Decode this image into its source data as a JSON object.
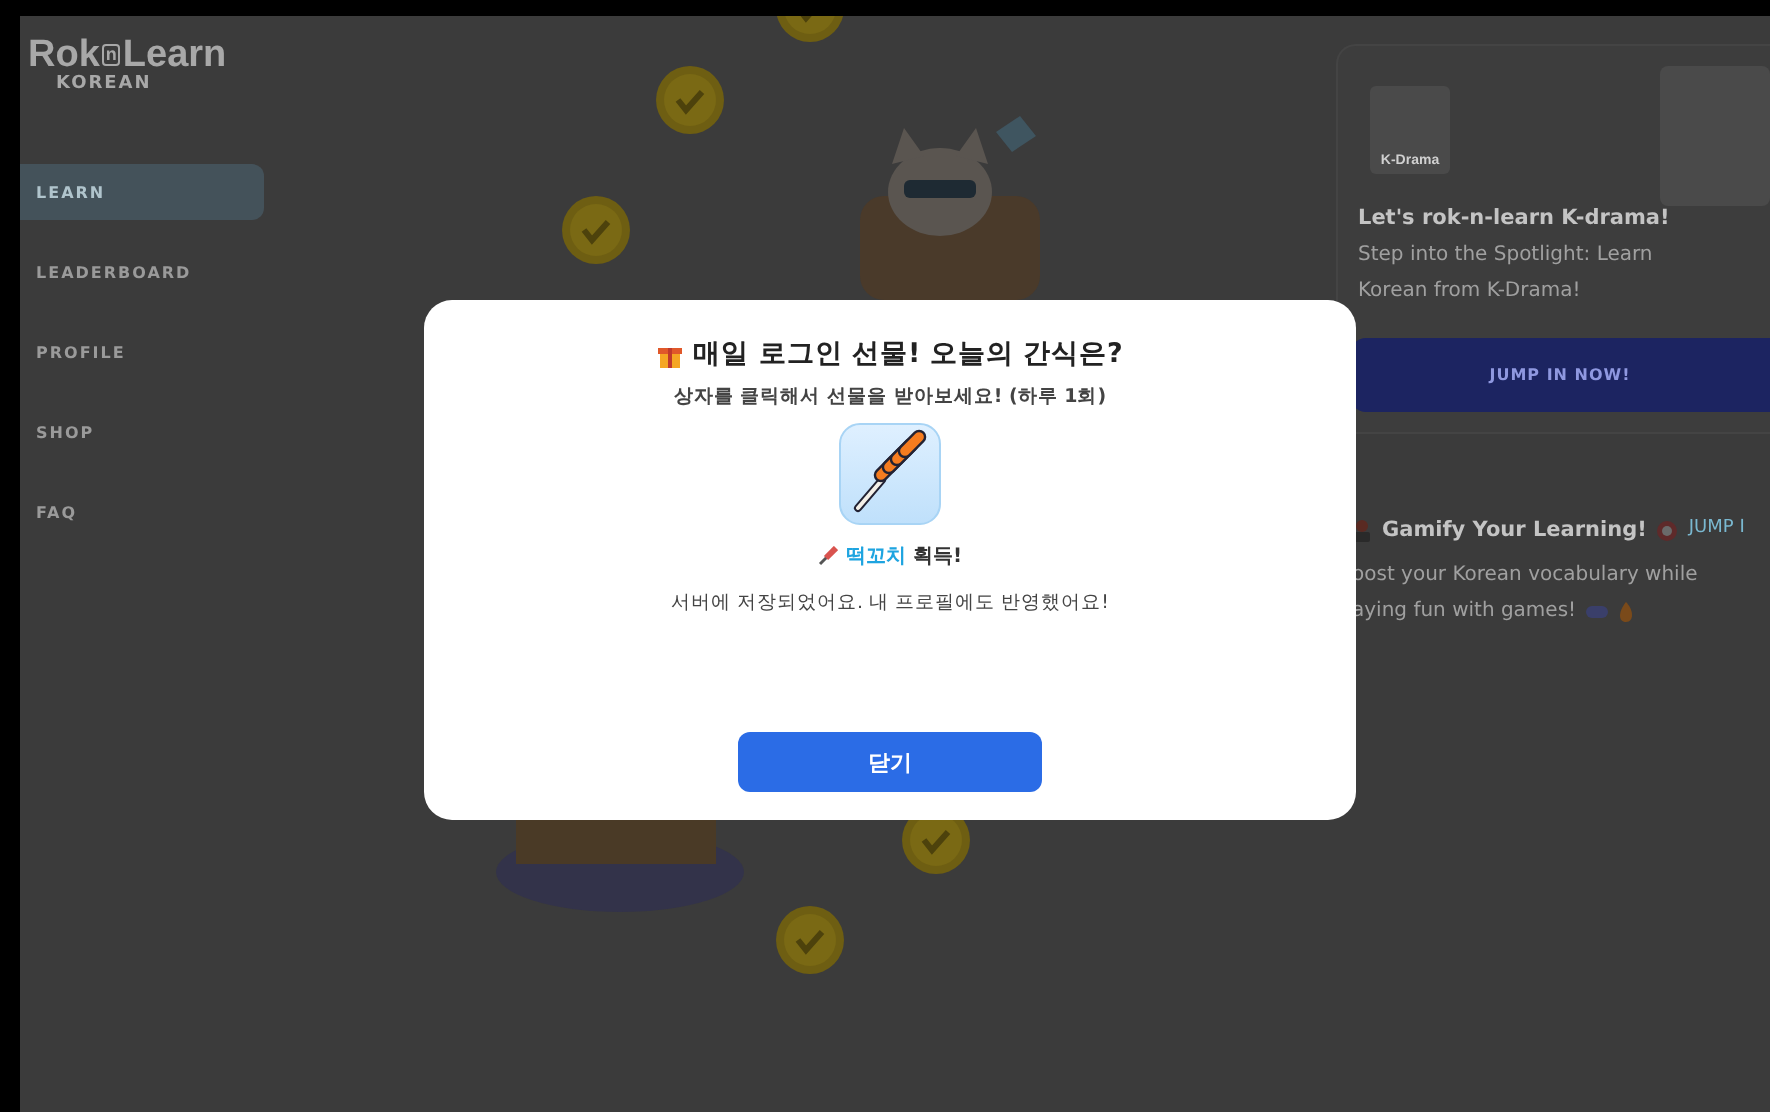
{
  "logo": {
    "parts": [
      "Rok",
      "n",
      "Learn"
    ],
    "subtitle": "KOREAN"
  },
  "sidebar": {
    "items": [
      {
        "label": "LEARN",
        "selected": true
      },
      {
        "label": "LEADERBOARD",
        "selected": false
      },
      {
        "label": "PROFILE",
        "selected": false
      },
      {
        "label": "SHOP",
        "selected": false
      },
      {
        "label": "FAQ",
        "selected": false
      }
    ]
  },
  "promo_cards": [
    {
      "kind": "feature",
      "badge": "K-Drama",
      "title": "Let's rok-n-learn K-drama!",
      "description": "Step into the Spotlight: Learn Korean from K-Drama!",
      "button": "JUMP IN NOW!"
    },
    {
      "kind": "inline",
      "title": "Gamify Your Learning!",
      "link": "JUMP I",
      "description_lines": [
        "oost your Korean vocabulary while",
        "aying fun with games!"
      ]
    }
  ],
  "dialog": {
    "title": "매일 로그인 선물! 오늘의 간식은?",
    "subtitle": "상자를 클릭해서 선물을 받아보세요! (하루 1회)",
    "reward_name": "떡꼬치",
    "reward_suffix": "획득!",
    "message": "서버에 저장되었어요. 내 프로필에도 반영했어요!",
    "close_button": "닫기"
  }
}
